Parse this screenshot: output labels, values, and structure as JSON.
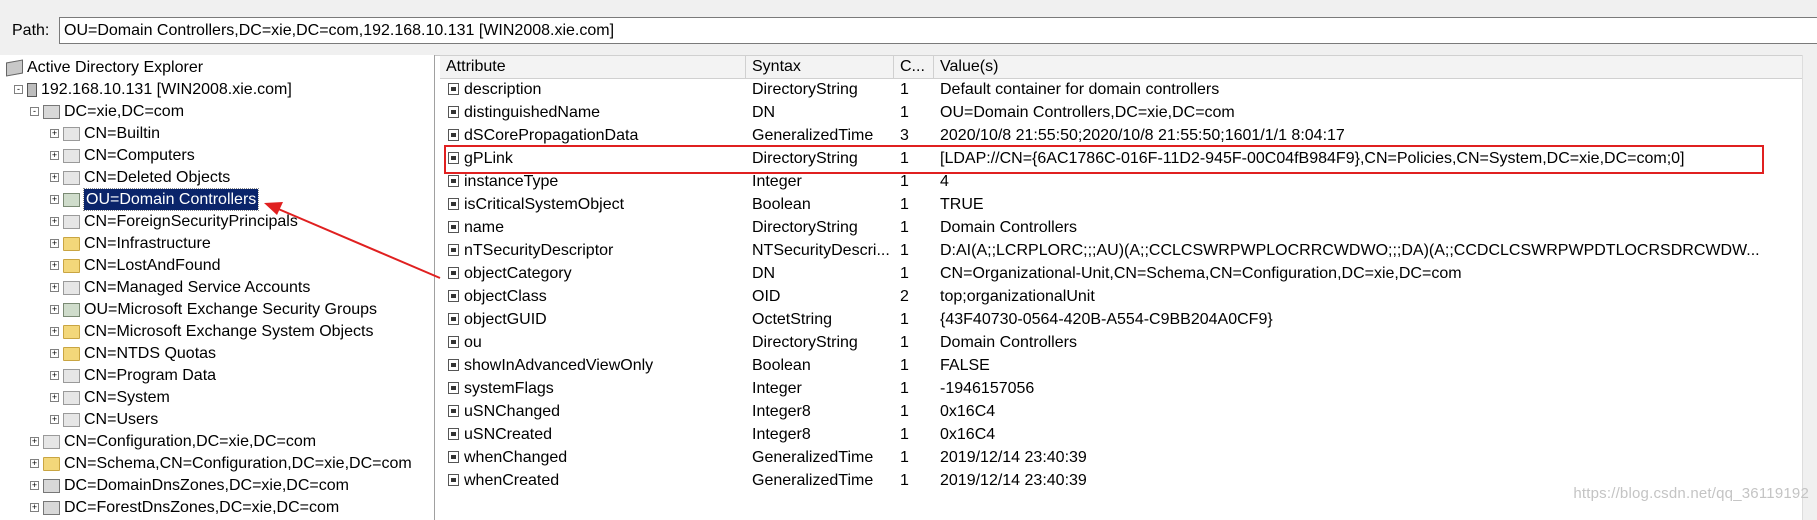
{
  "pathbar": {
    "label": "Path:",
    "value": "OU=Domain Controllers,DC=xie,DC=com,192.168.10.131 [WIN2008.xie.com]"
  },
  "tree": {
    "nodes": [
      {
        "label": "Active Directory Explorer",
        "icon": "ad-explorer-icon",
        "expander": ""
      },
      {
        "label": "192.168.10.131 [WIN2008.xie.com]",
        "icon": "server-icon",
        "expander": "-"
      },
      {
        "label": "DC=xie,DC=com",
        "icon": "domain-icon",
        "expander": "-"
      },
      {
        "label": "CN=Builtin",
        "icon": "container-icon",
        "expander": "+"
      },
      {
        "label": "CN=Computers",
        "icon": "container-icon",
        "expander": "+"
      },
      {
        "label": "CN=Deleted Objects",
        "icon": "container-icon",
        "expander": "+"
      },
      {
        "label": "OU=Domain Controllers",
        "icon": "ou-icon",
        "expander": "+"
      },
      {
        "label": "CN=ForeignSecurityPrincipals",
        "icon": "container-icon",
        "expander": "+"
      },
      {
        "label": "CN=Infrastructure",
        "icon": "folder-icon",
        "expander": "+"
      },
      {
        "label": "CN=LostAndFound",
        "icon": "folder-icon",
        "expander": "+"
      },
      {
        "label": "CN=Managed Service Accounts",
        "icon": "container-icon",
        "expander": "+"
      },
      {
        "label": "OU=Microsoft Exchange Security Groups",
        "icon": "ou-icon",
        "expander": "+"
      },
      {
        "label": "CN=Microsoft Exchange System Objects",
        "icon": "folder-icon",
        "expander": "+"
      },
      {
        "label": "CN=NTDS Quotas",
        "icon": "folder-icon",
        "expander": "+"
      },
      {
        "label": "CN=Program Data",
        "icon": "container-icon",
        "expander": "+"
      },
      {
        "label": "CN=System",
        "icon": "container-icon",
        "expander": "+"
      },
      {
        "label": "CN=Users",
        "icon": "container-icon",
        "expander": "+"
      },
      {
        "label": "CN=Configuration,DC=xie,DC=com",
        "icon": "config-icon",
        "expander": "+"
      },
      {
        "label": "CN=Schema,CN=Configuration,DC=xie,DC=com",
        "icon": "folder-icon",
        "expander": "+"
      },
      {
        "label": "DC=DomainDnsZones,DC=xie,DC=com",
        "icon": "domain-icon",
        "expander": "+"
      },
      {
        "label": "DC=ForestDnsZones,DC=xie,DC=com",
        "icon": "domain-icon",
        "expander": "+"
      }
    ],
    "selected": "OU=Domain Controllers"
  },
  "grid": {
    "columns": [
      "Attribute",
      "Syntax",
      "C...",
      "Value(s)"
    ],
    "rows": [
      {
        "attribute": "description",
        "syntax": "DirectoryString",
        "count": "1",
        "value": "Default container for domain controllers"
      },
      {
        "attribute": "distinguishedName",
        "syntax": "DN",
        "count": "1",
        "value": "OU=Domain Controllers,DC=xie,DC=com"
      },
      {
        "attribute": "dSCorePropagationData",
        "syntax": "GeneralizedTime",
        "count": "3",
        "value": "2020/10/8 21:55:50;2020/10/8 21:55:50;1601/1/1 8:04:17"
      },
      {
        "attribute": "gPLink",
        "syntax": "DirectoryString",
        "count": "1",
        "value": "[LDAP://CN={6AC1786C-016F-11D2-945F-00C04fB984F9},CN=Policies,CN=System,DC=xie,DC=com;0]"
      },
      {
        "attribute": "instanceType",
        "syntax": "Integer",
        "count": "1",
        "value": "4"
      },
      {
        "attribute": "isCriticalSystemObject",
        "syntax": "Boolean",
        "count": "1",
        "value": "TRUE"
      },
      {
        "attribute": "name",
        "syntax": "DirectoryString",
        "count": "1",
        "value": "Domain Controllers"
      },
      {
        "attribute": "nTSecurityDescriptor",
        "syntax": "NTSecurityDescri...",
        "count": "1",
        "value": "D:AI(A;;LCRPLORC;;;AU)(A;;CCLCSWRPWPLOCRRCWDWO;;;DA)(A;;CCDCLCSWRPWPDTLOCRSDRCWDW..."
      },
      {
        "attribute": "objectCategory",
        "syntax": "DN",
        "count": "1",
        "value": "CN=Organizational-Unit,CN=Schema,CN=Configuration,DC=xie,DC=com"
      },
      {
        "attribute": "objectClass",
        "syntax": "OID",
        "count": "2",
        "value": "top;organizationalUnit"
      },
      {
        "attribute": "objectGUID",
        "syntax": "OctetString",
        "count": "1",
        "value": "{43F40730-0564-420B-A554-C9BB204A0CF9}"
      },
      {
        "attribute": "ou",
        "syntax": "DirectoryString",
        "count": "1",
        "value": "Domain Controllers"
      },
      {
        "attribute": "showInAdvancedViewOnly",
        "syntax": "Boolean",
        "count": "1",
        "value": "FALSE"
      },
      {
        "attribute": "systemFlags",
        "syntax": "Integer",
        "count": "1",
        "value": "-1946157056"
      },
      {
        "attribute": "uSNChanged",
        "syntax": "Integer8",
        "count": "1",
        "value": "0x16C4"
      },
      {
        "attribute": "uSNCreated",
        "syntax": "Integer8",
        "count": "1",
        "value": "0x16C4"
      },
      {
        "attribute": "whenChanged",
        "syntax": "GeneralizedTime",
        "count": "1",
        "value": "2019/12/14 23:40:39"
      },
      {
        "attribute": "whenCreated",
        "syntax": "GeneralizedTime",
        "count": "1",
        "value": "2019/12/14 23:40:39"
      }
    ],
    "highlighted_attribute": "gPLink"
  },
  "annotation": {
    "color": "#e02020"
  },
  "watermark": "https://blog.csdn.net/qq_36119192"
}
